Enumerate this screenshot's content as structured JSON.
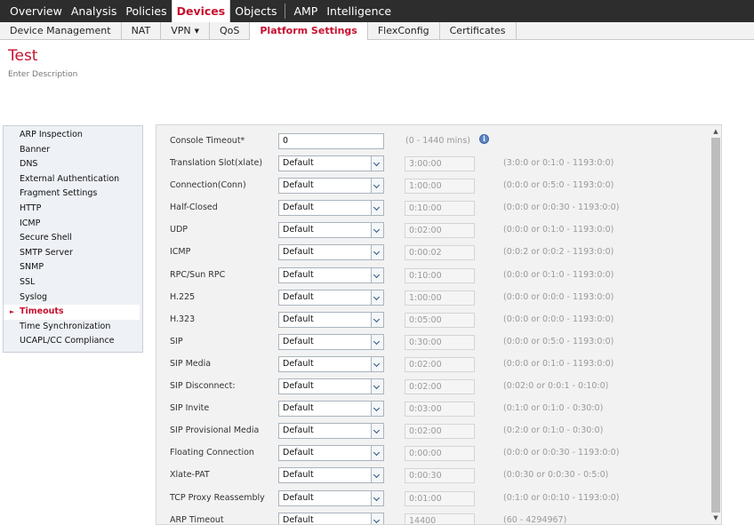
{
  "topnav": {
    "items": [
      {
        "label": "Overview",
        "active": false
      },
      {
        "label": "Analysis",
        "active": false
      },
      {
        "label": "Policies",
        "active": false
      },
      {
        "label": "Devices",
        "active": true
      },
      {
        "label": "Objects",
        "active": false
      },
      {
        "label": "AMP",
        "active": false
      },
      {
        "label": "Intelligence",
        "active": false
      }
    ]
  },
  "subnav": {
    "tabs": [
      {
        "label": "Device Management"
      },
      {
        "label": "NAT"
      },
      {
        "label": "VPN",
        "caret": "▼"
      },
      {
        "label": "QoS"
      },
      {
        "label": "Platform Settings",
        "active": true
      },
      {
        "label": "FlexConfig"
      },
      {
        "label": "Certificates"
      }
    ]
  },
  "policy": {
    "name": "Test",
    "description": "Enter Description"
  },
  "sidebar": {
    "active_marker": "►",
    "items": [
      {
        "label": "ARP Inspection"
      },
      {
        "label": "Banner"
      },
      {
        "label": "DNS"
      },
      {
        "label": "External Authentication"
      },
      {
        "label": "Fragment Settings"
      },
      {
        "label": "HTTP"
      },
      {
        "label": "ICMP"
      },
      {
        "label": "Secure Shell"
      },
      {
        "label": "SMTP Server"
      },
      {
        "label": "SNMP"
      },
      {
        "label": "SSL"
      },
      {
        "label": "Syslog"
      },
      {
        "label": "Timeouts",
        "active": true
      },
      {
        "label": "Time Synchronization"
      },
      {
        "label": "UCAPL/CC Compliance"
      }
    ]
  },
  "console": {
    "label": "Console Timeout*",
    "value": "0",
    "range": "(0 - 1440 mins)",
    "info_icon": "i"
  },
  "timeouts": [
    {
      "label": "Translation Slot(xlate)",
      "mode": "Default",
      "value": "3:00:00",
      "range": "(3:0:0 or 0:1:0 - 1193:0:0)"
    },
    {
      "label": "Connection(Conn)",
      "mode": "Default",
      "value": "1:00:00",
      "range": "(0:0:0 or 0:5:0 - 1193:0:0)"
    },
    {
      "label": "Half-Closed",
      "mode": "Default",
      "value": "0:10:00",
      "range": "(0:0:0 or 0:0:30 - 1193:0:0)"
    },
    {
      "label": "UDP",
      "mode": "Default",
      "value": "0:02:00",
      "range": "(0:0:0 or 0:1:0 - 1193:0:0)"
    },
    {
      "label": "ICMP",
      "mode": "Default",
      "value": "0:00:02",
      "range": "(0:0:2 or 0:0:2 - 1193:0:0)"
    },
    {
      "label": "RPC/Sun RPC",
      "mode": "Default",
      "value": "0:10:00",
      "range": "(0:0:0 or 0:1:0 - 1193:0:0)"
    },
    {
      "label": "H.225",
      "mode": "Default",
      "value": "1:00:00",
      "range": "(0:0:0 or 0:0:0 - 1193:0:0)"
    },
    {
      "label": "H.323",
      "mode": "Default",
      "value": "0:05:00",
      "range": "(0:0:0 or 0:0:0 - 1193:0:0)"
    },
    {
      "label": "SIP",
      "mode": "Default",
      "value": "0:30:00",
      "range": "(0:0:0 or 0:5:0 - 1193:0:0)"
    },
    {
      "label": "SIP Media",
      "mode": "Default",
      "value": "0:02:00",
      "range": "(0:0:0 or 0:1:0 - 1193:0:0)"
    },
    {
      "label": "SIP Disconnect:",
      "mode": "Default",
      "value": "0:02:00",
      "range": "(0:02:0 or 0:0:1 - 0:10:0)"
    },
    {
      "label": "SIP Invite",
      "mode": "Default",
      "value": "0:03:00",
      "range": "(0:1:0 or 0:1:0 - 0:30:0)"
    },
    {
      "label": "SIP Provisional Media",
      "mode": "Default",
      "value": "0:02:00",
      "range": "(0:2:0 or 0:1:0 - 0:30:0)"
    },
    {
      "label": "Floating Connection",
      "mode": "Default",
      "value": "0:00:00",
      "range": "(0:0:0 or 0:0:30 - 1193:0:0)"
    },
    {
      "label": "Xlate-PAT",
      "mode": "Default",
      "value": "0:00:30",
      "range": "(0:0:30 or 0:0:30 - 0:5:0)"
    },
    {
      "label": "TCP Proxy Reassembly",
      "mode": "Default",
      "value": "0:01:00",
      "range": "(0:1:0 or 0:0:10 - 1193:0:0)"
    },
    {
      "label": "ARP Timeout",
      "mode": "Default",
      "value": "14400",
      "range": "(60 - 4294967)"
    }
  ],
  "scrollbar": {
    "up": "▲",
    "down": "▼"
  }
}
